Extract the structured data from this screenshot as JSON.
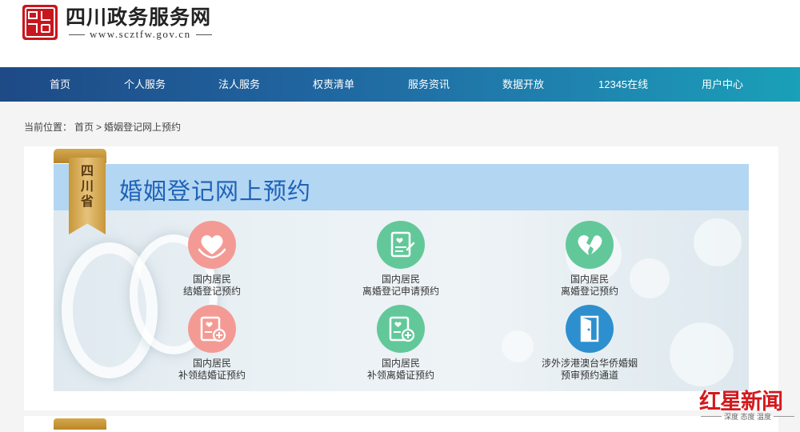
{
  "header": {
    "logo_glyph": "四川",
    "title": "四川政务服务网",
    "url": "www.scztfw.gov.cn"
  },
  "nav": {
    "items": [
      "首页",
      "个人服务",
      "法人服务",
      "权责清单",
      "服务资讯",
      "数据开放",
      "12345在线",
      "用户中心"
    ]
  },
  "breadcrumb": {
    "prefix": "当前位置：",
    "home": "首页",
    "sep": ">",
    "current": "婚姻登记网上预约"
  },
  "ribbon": {
    "text": "四川省",
    "color": "#c8973a"
  },
  "banner": {
    "title": "婚姻登记网上预约",
    "title_color": "#1f62b7"
  },
  "services": [
    {
      "line1": "国内居民",
      "line2": "结婚登记预约",
      "icon": "heart-hands-icon",
      "color": "#f49a94"
    },
    {
      "line1": "国内居民",
      "line2": "离婚登记申请预约",
      "icon": "form-document-icon",
      "color": "#62c89a"
    },
    {
      "line1": "国内居民",
      "line2": "离婚登记预约",
      "icon": "broken-heart-icon",
      "color": "#62c89a"
    },
    {
      "line1": "国内居民",
      "line2": "补领结婚证预约",
      "icon": "certificate-add-icon",
      "color": "#f49a94"
    },
    {
      "line1": "国内居民",
      "line2": "补领离婚证预约",
      "icon": "certificate-add-icon",
      "color": "#62c89a"
    },
    {
      "line1": "涉外涉港澳台华侨婚姻",
      "line2": "预审预约通道",
      "icon": "open-door-icon",
      "color": "#2d8fce"
    }
  ],
  "watermark": {
    "title": "红星新闻",
    "subtitle": "深度 态度 温度",
    "color": "#d3191e"
  }
}
